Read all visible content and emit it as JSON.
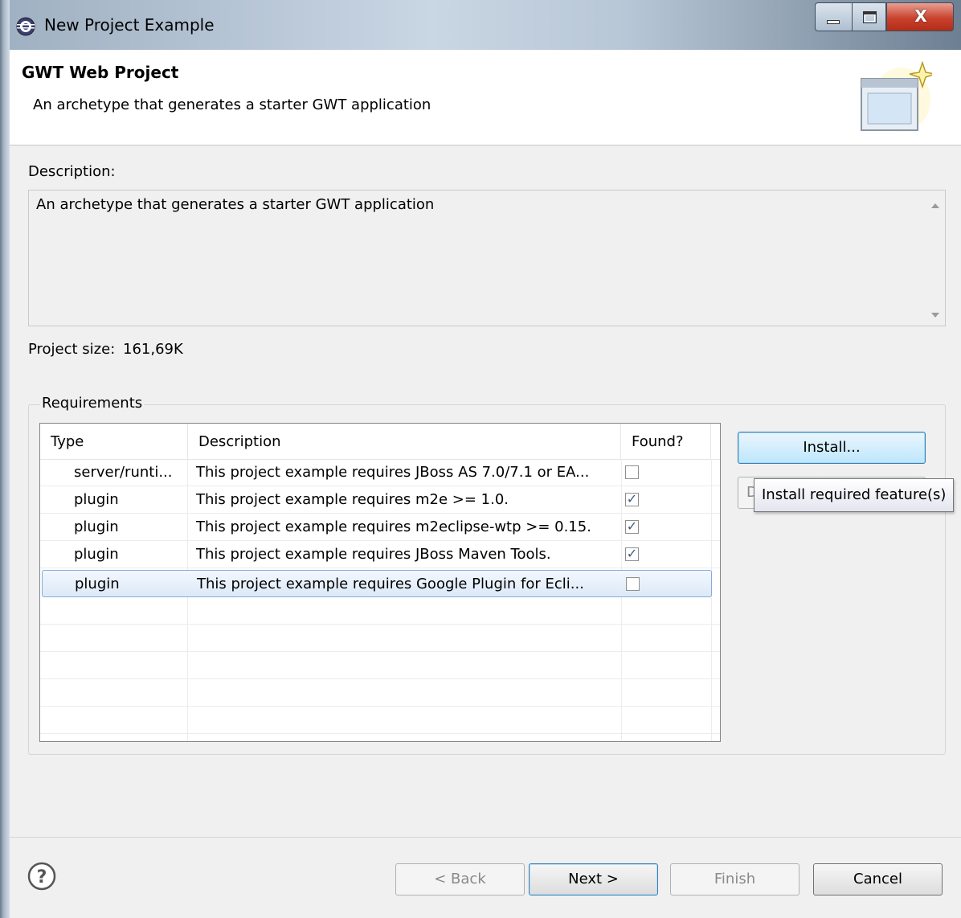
{
  "window": {
    "title": "New Project Example",
    "close_glyph": "X"
  },
  "header": {
    "title": "GWT Web Project",
    "subtitle": "An archetype that generates a starter GWT application"
  },
  "description": {
    "label": "Description:",
    "text": "An archetype that generates a starter GWT application"
  },
  "project_size": {
    "label": "Project size:",
    "value": "161,69K"
  },
  "requirements": {
    "group_label": "Requirements",
    "columns": [
      "Type",
      "Description",
      "Found?"
    ],
    "rows": [
      {
        "type": "server/runti...",
        "description": "This project example requires JBoss AS 7.0/7.1 or EA...",
        "found": ""
      },
      {
        "type": "plugin",
        "description": "This project example requires m2e >= 1.0.",
        "found": "✓"
      },
      {
        "type": "plugin",
        "description": "This project example requires m2eclipse-wtp >= 0.15.",
        "found": "✓"
      },
      {
        "type": "plugin",
        "description": "This project example requires JBoss Maven Tools.",
        "found": "✓"
      },
      {
        "type": "plugin",
        "description": "This project example requires Google Plugin for Ecli...",
        "found": ""
      }
    ],
    "selected_row": 4,
    "install_button": "Install...",
    "disabled_button_fragment": "D",
    "tooltip": "Install required feature(s)"
  },
  "footer": {
    "help_glyph": "?",
    "back": "< Back",
    "next": "Next >",
    "finish": "Finish",
    "cancel": "Cancel"
  },
  "colors": {
    "selection": "#dde9f8",
    "primary_button": "#bee6fd",
    "close_button": "#c9422e"
  },
  "icons": [
    "eclipse-app-icon",
    "minimize-icon",
    "maximize-icon",
    "close-icon",
    "wizard-banner-icon",
    "help-icon",
    "checkbox-icon",
    "scroll-up-icon",
    "scroll-down-icon"
  ]
}
